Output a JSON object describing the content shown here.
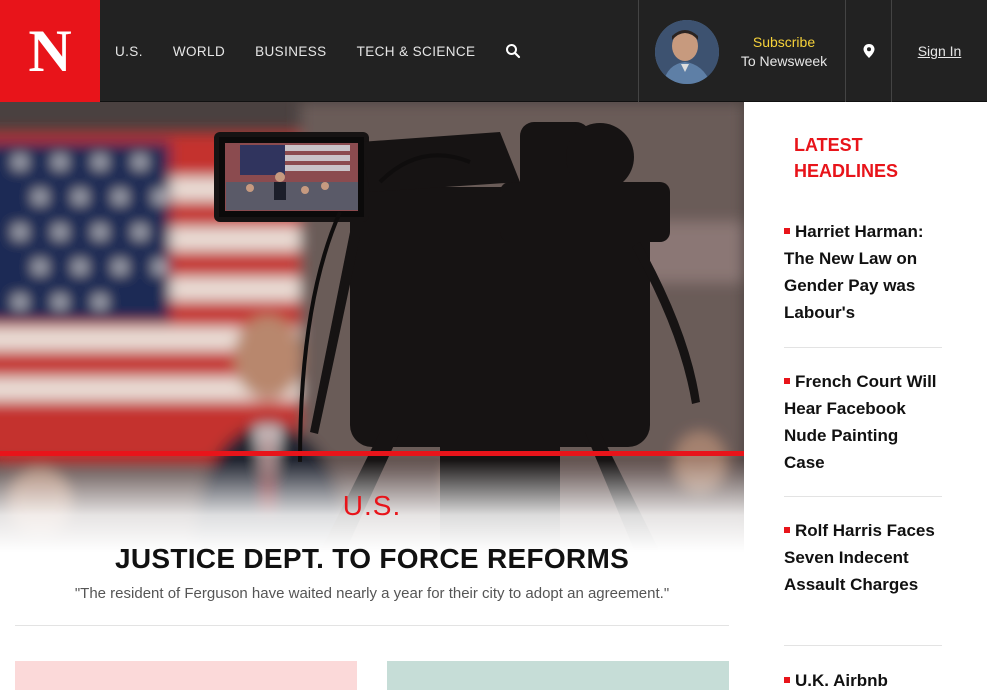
{
  "logo": {
    "letter": "N"
  },
  "nav": {
    "items": [
      "U.S.",
      "WORLD",
      "BUSINESS",
      "TECH & SCIENCE"
    ]
  },
  "subscribe": {
    "line1": "Subscribe",
    "line2": "To Newsweek"
  },
  "signin": "Sign In",
  "hero": {
    "section": "U.S.",
    "headline": "JUSTICE DEPT. TO FORCE REFORMS",
    "dek": "\"The resident of Ferguson have waited nearly a year for their city to adopt an agreement.\""
  },
  "sidebar": {
    "title": "LATEST HEADLINES",
    "headlines": [
      "Harriet Harman: The New Law on Gender Pay was Labour's",
      "French Court Will Hear Facebook Nude Painting Case",
      "Rolf Harris Faces Seven Indecent Assault Charges",
      "U.K. Airbnb"
    ]
  },
  "colors": {
    "brand_red": "#e8141a",
    "header_bg": "#222222",
    "subscribe_yellow": "#f6d23a"
  },
  "icons": [
    "search-icon",
    "location-pin-icon"
  ]
}
